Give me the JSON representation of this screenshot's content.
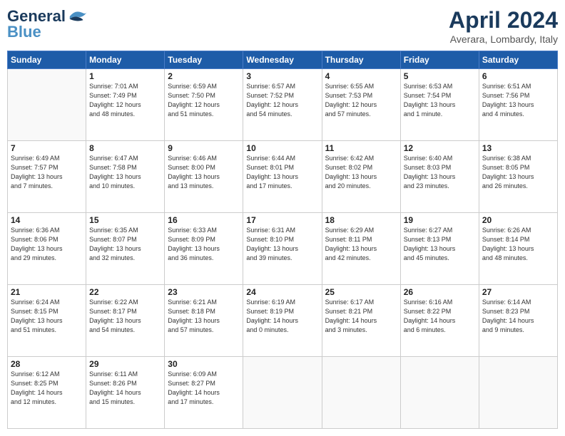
{
  "header": {
    "logo_line1": "General",
    "logo_line2": "Blue",
    "month": "April 2024",
    "location": "Averara, Lombardy, Italy"
  },
  "weekdays": [
    "Sunday",
    "Monday",
    "Tuesday",
    "Wednesday",
    "Thursday",
    "Friday",
    "Saturday"
  ],
  "weeks": [
    [
      {
        "day": "",
        "info": ""
      },
      {
        "day": "1",
        "info": "Sunrise: 7:01 AM\nSunset: 7:49 PM\nDaylight: 12 hours\nand 48 minutes."
      },
      {
        "day": "2",
        "info": "Sunrise: 6:59 AM\nSunset: 7:50 PM\nDaylight: 12 hours\nand 51 minutes."
      },
      {
        "day": "3",
        "info": "Sunrise: 6:57 AM\nSunset: 7:52 PM\nDaylight: 12 hours\nand 54 minutes."
      },
      {
        "day": "4",
        "info": "Sunrise: 6:55 AM\nSunset: 7:53 PM\nDaylight: 12 hours\nand 57 minutes."
      },
      {
        "day": "5",
        "info": "Sunrise: 6:53 AM\nSunset: 7:54 PM\nDaylight: 13 hours\nand 1 minute."
      },
      {
        "day": "6",
        "info": "Sunrise: 6:51 AM\nSunset: 7:56 PM\nDaylight: 13 hours\nand 4 minutes."
      }
    ],
    [
      {
        "day": "7",
        "info": "Sunrise: 6:49 AM\nSunset: 7:57 PM\nDaylight: 13 hours\nand 7 minutes."
      },
      {
        "day": "8",
        "info": "Sunrise: 6:47 AM\nSunset: 7:58 PM\nDaylight: 13 hours\nand 10 minutes."
      },
      {
        "day": "9",
        "info": "Sunrise: 6:46 AM\nSunset: 8:00 PM\nDaylight: 13 hours\nand 13 minutes."
      },
      {
        "day": "10",
        "info": "Sunrise: 6:44 AM\nSunset: 8:01 PM\nDaylight: 13 hours\nand 17 minutes."
      },
      {
        "day": "11",
        "info": "Sunrise: 6:42 AM\nSunset: 8:02 PM\nDaylight: 13 hours\nand 20 minutes."
      },
      {
        "day": "12",
        "info": "Sunrise: 6:40 AM\nSunset: 8:03 PM\nDaylight: 13 hours\nand 23 minutes."
      },
      {
        "day": "13",
        "info": "Sunrise: 6:38 AM\nSunset: 8:05 PM\nDaylight: 13 hours\nand 26 minutes."
      }
    ],
    [
      {
        "day": "14",
        "info": "Sunrise: 6:36 AM\nSunset: 8:06 PM\nDaylight: 13 hours\nand 29 minutes."
      },
      {
        "day": "15",
        "info": "Sunrise: 6:35 AM\nSunset: 8:07 PM\nDaylight: 13 hours\nand 32 minutes."
      },
      {
        "day": "16",
        "info": "Sunrise: 6:33 AM\nSunset: 8:09 PM\nDaylight: 13 hours\nand 36 minutes."
      },
      {
        "day": "17",
        "info": "Sunrise: 6:31 AM\nSunset: 8:10 PM\nDaylight: 13 hours\nand 39 minutes."
      },
      {
        "day": "18",
        "info": "Sunrise: 6:29 AM\nSunset: 8:11 PM\nDaylight: 13 hours\nand 42 minutes."
      },
      {
        "day": "19",
        "info": "Sunrise: 6:27 AM\nSunset: 8:13 PM\nDaylight: 13 hours\nand 45 minutes."
      },
      {
        "day": "20",
        "info": "Sunrise: 6:26 AM\nSunset: 8:14 PM\nDaylight: 13 hours\nand 48 minutes."
      }
    ],
    [
      {
        "day": "21",
        "info": "Sunrise: 6:24 AM\nSunset: 8:15 PM\nDaylight: 13 hours\nand 51 minutes."
      },
      {
        "day": "22",
        "info": "Sunrise: 6:22 AM\nSunset: 8:17 PM\nDaylight: 13 hours\nand 54 minutes."
      },
      {
        "day": "23",
        "info": "Sunrise: 6:21 AM\nSunset: 8:18 PM\nDaylight: 13 hours\nand 57 minutes."
      },
      {
        "day": "24",
        "info": "Sunrise: 6:19 AM\nSunset: 8:19 PM\nDaylight: 14 hours\nand 0 minutes."
      },
      {
        "day": "25",
        "info": "Sunrise: 6:17 AM\nSunset: 8:21 PM\nDaylight: 14 hours\nand 3 minutes."
      },
      {
        "day": "26",
        "info": "Sunrise: 6:16 AM\nSunset: 8:22 PM\nDaylight: 14 hours\nand 6 minutes."
      },
      {
        "day": "27",
        "info": "Sunrise: 6:14 AM\nSunset: 8:23 PM\nDaylight: 14 hours\nand 9 minutes."
      }
    ],
    [
      {
        "day": "28",
        "info": "Sunrise: 6:12 AM\nSunset: 8:25 PM\nDaylight: 14 hours\nand 12 minutes."
      },
      {
        "day": "29",
        "info": "Sunrise: 6:11 AM\nSunset: 8:26 PM\nDaylight: 14 hours\nand 15 minutes."
      },
      {
        "day": "30",
        "info": "Sunrise: 6:09 AM\nSunset: 8:27 PM\nDaylight: 14 hours\nand 17 minutes."
      },
      {
        "day": "",
        "info": ""
      },
      {
        "day": "",
        "info": ""
      },
      {
        "day": "",
        "info": ""
      },
      {
        "day": "",
        "info": ""
      }
    ]
  ]
}
